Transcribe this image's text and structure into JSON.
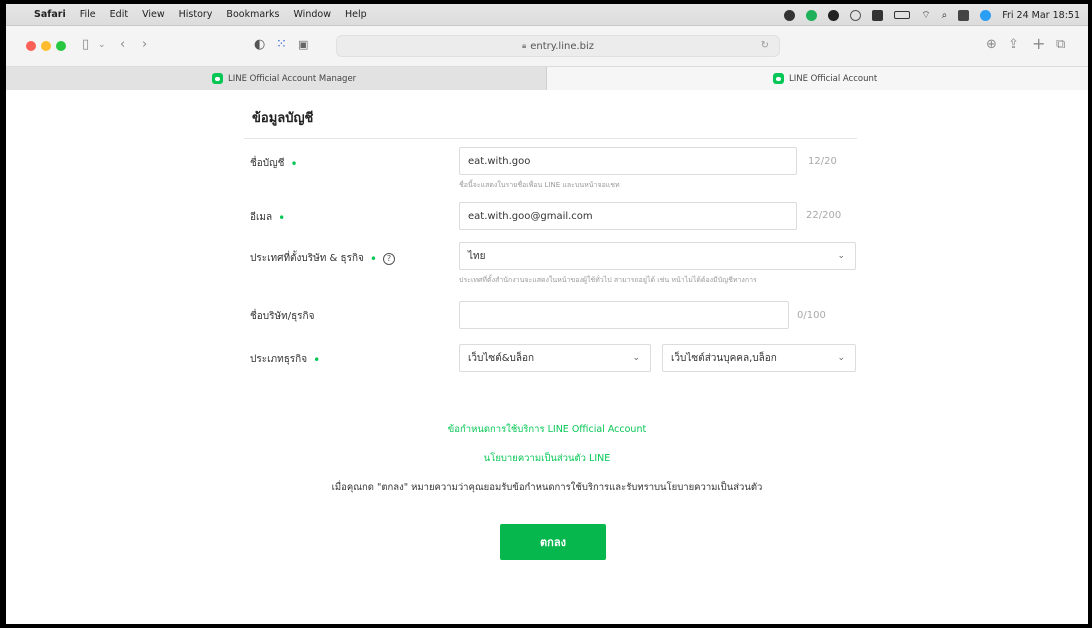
{
  "menubar": {
    "apple": "",
    "items": [
      "Safari",
      "File",
      "Edit",
      "View",
      "History",
      "Bookmarks",
      "Window",
      "Help"
    ],
    "datetime": "Fri 24 Mar 18:51"
  },
  "toolbar": {
    "url": "entry.line.biz"
  },
  "tabs": [
    {
      "label": "LINE Official Account Manager",
      "active": false
    },
    {
      "label": "LINE Official Account",
      "active": true
    }
  ],
  "form": {
    "section_title": "ข้อมูลบัญชี",
    "account_name": {
      "label": "ชื่อบัญชี",
      "value": "eat.with.goo",
      "counter": "12/20",
      "hint": "ชื่อนี้จะแสดงในรายชื่อเพื่อน LINE และบนหน้าจอแชท"
    },
    "email": {
      "label": "อีเมล",
      "value": "eat.with.goo@gmail.com",
      "counter": "22/200"
    },
    "country": {
      "label": "ประเทศที่ตั้งบริษัท & ธุรกิจ",
      "help": "?",
      "value": "ไทย",
      "hint": "ประเทศที่ตั้งสำนักงานจะแสดงในหน้าของผู้ใช้ทั่วไป สามารถอยู่ได้ เช่น หน้าไม่ได้ต้องมีบัญชีทางการ"
    },
    "company": {
      "label": "ชื่อบริษัท/ธุรกิจ",
      "value": "",
      "counter": "0/100"
    },
    "business_type": {
      "label": "ประเภทธุรกิจ",
      "category": "เว็บไซต์&บล็อก",
      "subcategory": "เว็บไซต์ส่วนบุคคล,บล็อก"
    },
    "terms_link": "ข้อกำหนดการใช้บริการ LINE Official Account",
    "privacy_link": "นโยบายความเป็นส่วนตัว LINE",
    "consent_text": "เมื่อคุณกด \"ตกลง\" หมายความว่าคุณยอมรับข้อกำหนดการใช้บริการและรับทราบนโยบายความเป็นส่วนตัว",
    "submit_label": "ตกลง"
  }
}
